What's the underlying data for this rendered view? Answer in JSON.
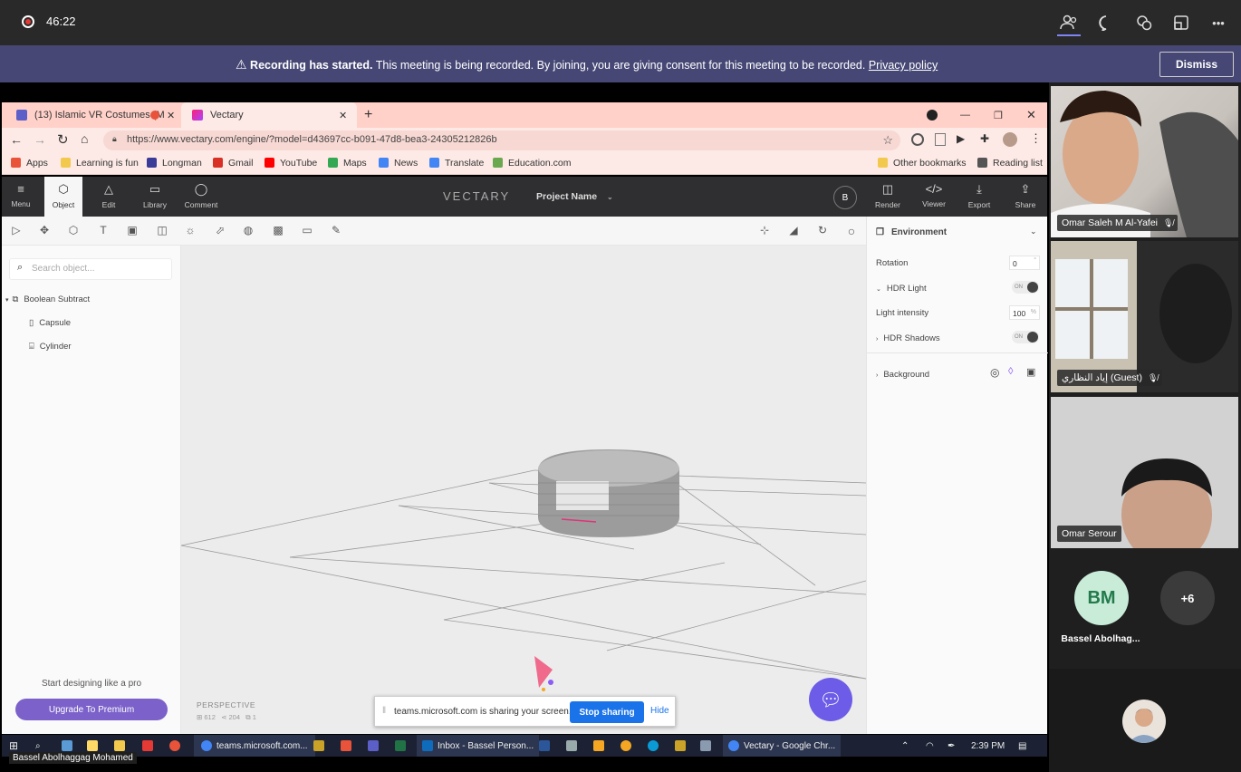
{
  "teams": {
    "recording_time": "46:22",
    "icons": [
      "people-icon",
      "chat-icon",
      "reactions-icon",
      "share-tray-icon",
      "more-icon"
    ],
    "more_label": "•••",
    "banner": {
      "bold": "Recording has started.",
      "text": "This meeting is being recorded. By joining, you are giving consent for this meeting to be recorded.",
      "link": "Privacy policy",
      "dismiss": "Dismiss"
    }
  },
  "browser": {
    "tabs": [
      {
        "label": "(13) Islamic VR Costumes (M",
        "active": false
      },
      {
        "label": "Vectary",
        "active": true
      }
    ],
    "new_tab": "+",
    "url": "https://www.vectary.com/engine/?model=d43697cc-b091-47d8-bea3-24305212826b",
    "bookmarks": [
      {
        "label": "Apps",
        "color": "#e8533a"
      },
      {
        "label": "Learning is fun",
        "color": "#f2c94c"
      },
      {
        "label": "Longman",
        "color": "#3b3b98"
      },
      {
        "label": "Gmail",
        "color": "#d93025"
      },
      {
        "label": "YouTube",
        "color": "#ff0000"
      },
      {
        "label": "Maps",
        "color": "#34a853"
      },
      {
        "label": "News",
        "color": "#4285f4"
      },
      {
        "label": "Translate",
        "color": "#4285f4"
      },
      {
        "label": "Education.com",
        "color": "#6aa84f"
      },
      {
        "label": "Other bookmarks",
        "color": "#f2c94c"
      },
      {
        "label": "Reading list",
        "color": "#555555"
      }
    ]
  },
  "vectary": {
    "tools": [
      {
        "label": "Menu",
        "icon": "≡"
      },
      {
        "label": "Object",
        "icon": "⬡"
      },
      {
        "label": "Edit",
        "icon": "△"
      },
      {
        "label": "Library",
        "icon": "▭"
      },
      {
        "label": "Comment",
        "icon": "◯"
      }
    ],
    "logo": "VECTARY",
    "project_name": "Project Name",
    "avatar_initial": "B",
    "right_tools": [
      {
        "label": "Render",
        "icon": "◫"
      },
      {
        "label": "Viewer",
        "icon": "</>"
      },
      {
        "label": "Export",
        "icon": "⤓"
      },
      {
        "label": "Share",
        "icon": "⇪"
      }
    ],
    "search_placeholder": "Search object...",
    "tree": [
      {
        "label": "Boolean Subtract",
        "level": 0
      },
      {
        "label": "Capsule",
        "level": 1
      },
      {
        "label": "Cylinder",
        "level": 1
      }
    ],
    "premium_text": "Start designing like a pro",
    "premium_button": "Upgrade To Premium",
    "camera_label": "PERSPECTIVE",
    "stats": [
      "612",
      "204",
      "1"
    ],
    "environment": {
      "title": "Environment",
      "rotation_label": "Rotation",
      "rotation_value": "0",
      "rotation_unit": "°",
      "hdr_light": "HDR Light",
      "hdr_light_state": "ON",
      "light_intensity_label": "Light intensity",
      "light_intensity_value": "100",
      "light_intensity_unit": "%",
      "hdr_shadows": "HDR Shadows",
      "hdr_shadows_state": "ON",
      "background": "Background"
    }
  },
  "share_popup": {
    "text": "teams.microsoft.com is sharing your screen.",
    "stop": "Stop sharing",
    "hide": "Hide"
  },
  "taskbar": {
    "items": [
      {
        "label": "teams.microsoft.com...",
        "color": "#4285f4"
      },
      {
        "label": "Inbox - Bassel Person...",
        "color": "#0f6cbd"
      },
      {
        "label": "Vectary - Google Chr...",
        "color": "#4285f4"
      }
    ],
    "time": "2:39 PM"
  },
  "presenter": "Bassel Abolhaggag Mohamed",
  "participants": [
    {
      "name": "Omar Saleh M Al-Yafei"
    },
    {
      "name": "إياد النظاري (Guest)"
    },
    {
      "name": "Omar Serour"
    }
  ],
  "avatars": {
    "bm_initials": "BM",
    "bm_name": "Bassel Abolhag...",
    "more_count": "+6",
    "bm_color": "#c9ecd9"
  }
}
